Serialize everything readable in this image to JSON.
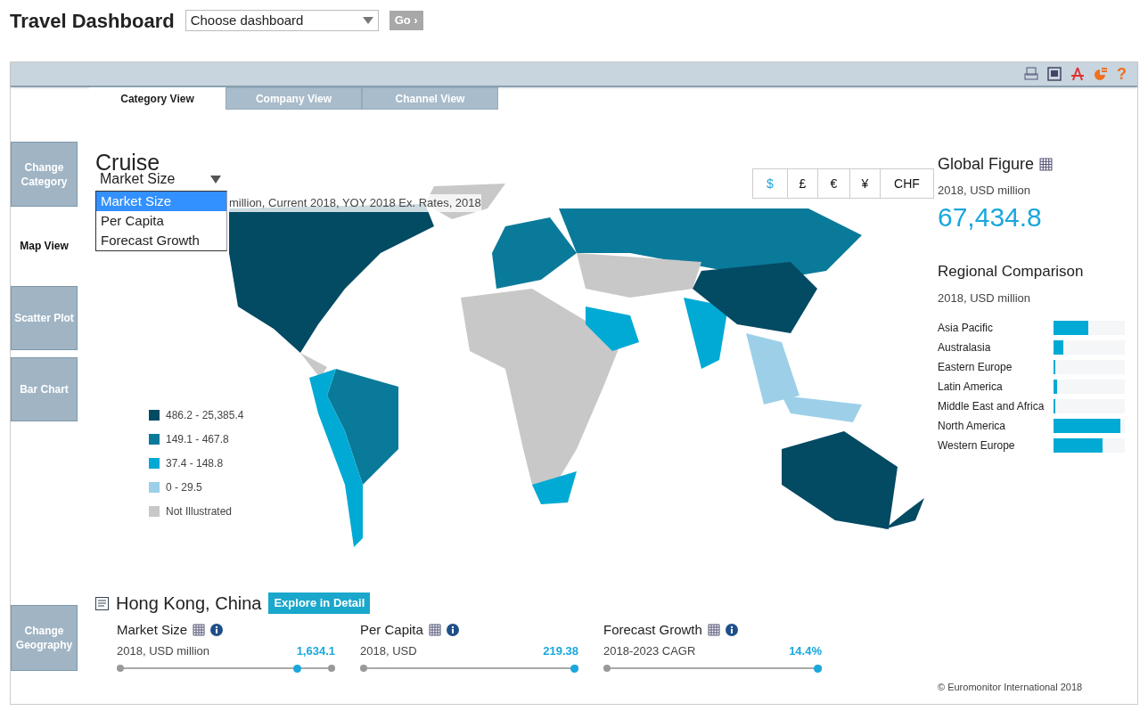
{
  "header": {
    "title": "Travel Dashboard",
    "dashboard_select": {
      "value": "Choose dashboard"
    },
    "go_button": "Go ›"
  },
  "toolbar_help": "?",
  "tabs": [
    {
      "label": "Category View",
      "selected": true
    },
    {
      "label": "Company View",
      "selected": false
    },
    {
      "label": "Channel View",
      "selected": false
    }
  ],
  "side_nav": [
    {
      "label": "Change Category",
      "selected": false
    },
    {
      "label": "Map View",
      "selected": true
    },
    {
      "label": "Scatter Plot",
      "selected": false
    },
    {
      "label": "Bar Chart",
      "selected": false
    },
    {
      "label": "Change Geography",
      "selected": false
    }
  ],
  "category": "Cruise",
  "measure_select": {
    "value": "Market Size",
    "options": [
      {
        "label": "Market Size",
        "selected": true
      },
      {
        "label": "Per Capita",
        "selected": false
      },
      {
        "label": "Forecast Growth",
        "selected": false
      }
    ]
  },
  "map_subtitle": "million, Current 2018, YOY 2018 Ex. Rates, 2018",
  "currencies": [
    {
      "label": "$",
      "selected": true
    },
    {
      "label": "£",
      "selected": false
    },
    {
      "label": "€",
      "selected": false
    },
    {
      "label": "¥",
      "selected": false
    },
    {
      "label": "CHF",
      "selected": false
    }
  ],
  "legend": [
    {
      "label": "486.2 - 25,385.4",
      "color": "#034a63"
    },
    {
      "label": "149.1 - 467.8",
      "color": "#0a7a9a"
    },
    {
      "label": "37.4 - 148.8",
      "color": "#00aad4"
    },
    {
      "label": "0 - 29.5",
      "color": "#9dd0e8"
    },
    {
      "label": "Not Illustrated",
      "color": "#c8c8c8"
    }
  ],
  "global_figure": {
    "title": "Global Figure",
    "subtitle": "2018, USD million",
    "value": "67,434.8"
  },
  "regional_comparison": {
    "title": "Regional Comparison",
    "subtitle": "2018, USD million",
    "rows": [
      {
        "label": "Asia Pacific",
        "level": 0.49
      },
      {
        "label": "Australasia",
        "level": 0.14
      },
      {
        "label": "Eastern Europe",
        "level": 0.02
      },
      {
        "label": "Latin America",
        "level": 0.05
      },
      {
        "label": "Middle East and Africa",
        "level": 0.01
      },
      {
        "label": "North America",
        "level": 0.94
      },
      {
        "label": "Western Europe",
        "level": 0.69
      }
    ]
  },
  "geography": {
    "name": "Hong Kong, China",
    "button": "Explore in Detail",
    "metrics": [
      {
        "title": "Market Size",
        "subtitle": "2018, USD million",
        "value": "1,634.1",
        "level": 0.84
      },
      {
        "title": "Per Capita",
        "subtitle": "2018, USD",
        "value": "219.38",
        "level": 1.0
      },
      {
        "title": "Forecast Growth",
        "subtitle": "2018-2023 CAGR",
        "value": "14.4%",
        "level": 1.0
      }
    ]
  },
  "copyright": "© Euromonitor International 2018"
}
